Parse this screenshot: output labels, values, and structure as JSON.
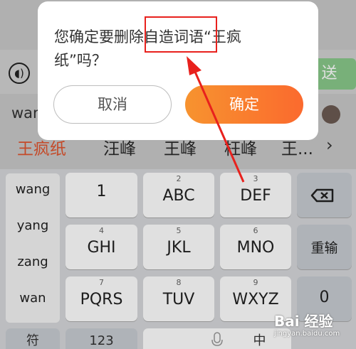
{
  "chat": {
    "send_label": "送",
    "typed_text": "wan",
    "candidates": [
      "王疯纸",
      "汪峰",
      "王峰",
      "枉峰",
      "王..."
    ]
  },
  "keyboard": {
    "pinyin": [
      "wang",
      "yang",
      "zang",
      "wan"
    ],
    "keys": [
      {
        "num": "",
        "label": "1"
      },
      {
        "num": "2",
        "label": "ABC"
      },
      {
        "num": "3",
        "label": "DEF"
      },
      {
        "num": "4",
        "label": "GHI"
      },
      {
        "num": "5",
        "label": "JKL"
      },
      {
        "num": "6",
        "label": "MNO"
      },
      {
        "num": "7",
        "label": "PQRS"
      },
      {
        "num": "8",
        "label": "TUV"
      },
      {
        "num": "9",
        "label": "WXYZ"
      }
    ],
    "reinput_label": "重输",
    "zero_label": "0",
    "bottom": [
      "符",
      "123",
      "中"
    ]
  },
  "dialog": {
    "message_line1": "您确定要删除自造词语“王疯",
    "message_line2": "纸”吗？",
    "cancel_label": "取消",
    "confirm_label": "确定"
  },
  "watermark": {
    "logo": "Bai 经验",
    "url": "jingyan.baidu.com"
  },
  "colors": {
    "confirm_gradient_start": "#f7932f",
    "confirm_gradient_end": "#fb6a2e",
    "highlight_red": "#e8211d",
    "candidate_highlight": "#e0552f"
  }
}
